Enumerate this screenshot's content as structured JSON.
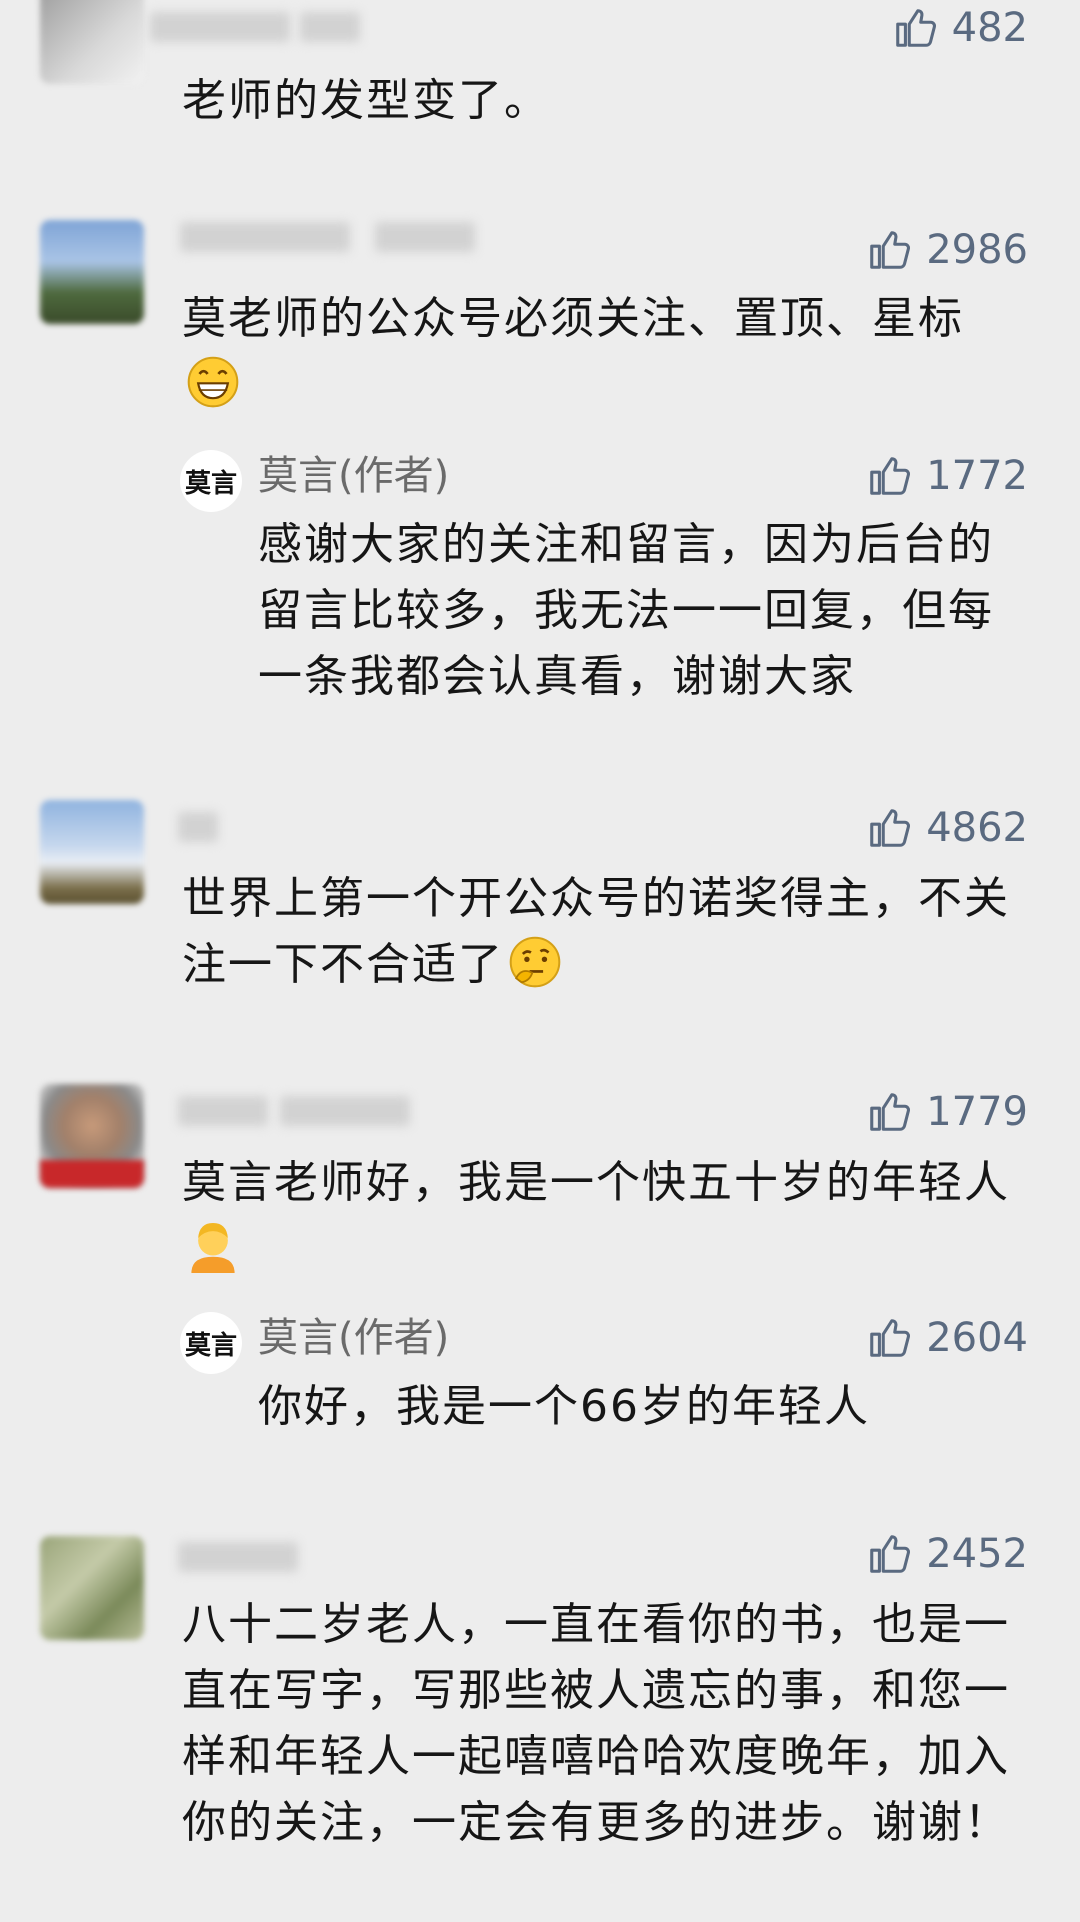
{
  "comments": [
    {
      "likes": "482",
      "text": "老师的发型变了。"
    },
    {
      "likes": "2986",
      "text": "莫老师的公众号必须关注、置顶、星标",
      "emoji": "grinning-face-emoji",
      "reply": {
        "avatar_text": "莫言",
        "author": "莫言(作者)",
        "likes": "1772",
        "text": "感谢大家的关注和留言，因为后台的留言比较多，我无法一一回复，但每一条我都会认真看，谢谢大家"
      }
    },
    {
      "likes": "4862",
      "text": "世界上第一个开公众号的诺奖得主，不关注一下不合适了",
      "emoji": "thinking-face-emoji"
    },
    {
      "likes": "1779",
      "text": "莫言老师好，我是一个快五十岁的年轻人",
      "emoji": "person-emoji",
      "reply": {
        "avatar_text": "莫言",
        "author": "莫言(作者)",
        "likes": "2604",
        "text": "你好，我是一个66岁的年轻人"
      }
    },
    {
      "likes": "2452",
      "text": "八十二岁老人，一直在看你的书，也是一直在写字，写那些被人遗忘的事，和您一样和年轻人一起嘻嘻哈哈欢度晚年，加入你的关注，一定会有更多的进步。谢谢！"
    }
  ],
  "icons": {
    "like": "thumbs-up-icon"
  },
  "colors": {
    "background": "#ededed",
    "like_color": "#5a6a80",
    "author_name": "#6a6a6a",
    "text": "#161616"
  }
}
